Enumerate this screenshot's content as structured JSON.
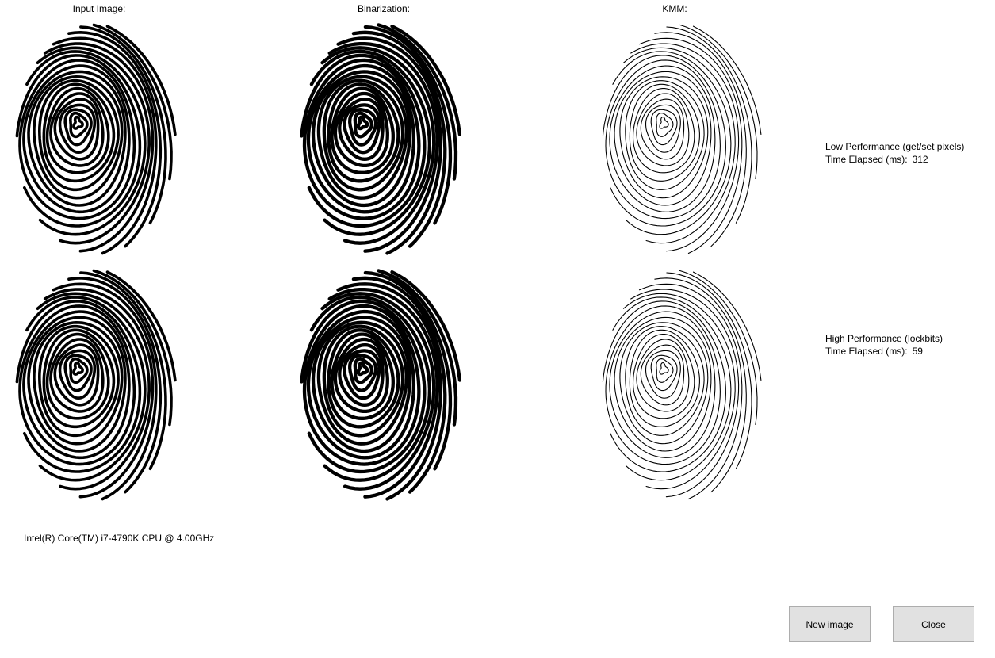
{
  "columns": {
    "input_title": "Input Image:",
    "binarization_title": "Binarization:",
    "kmm_title": "KMM:"
  },
  "low_performance": {
    "title": "Low Performance (get/set pixels)",
    "time_label": "Time Elapsed (ms):",
    "time_value": "312"
  },
  "high_performance": {
    "title": "High Performance (lockbits)",
    "time_label": "Time Elapsed (ms):",
    "time_value": "59"
  },
  "cpu": {
    "label": "Intel(R) Core(TM) i7-4790K CPU @ 4.00GHz"
  },
  "buttons": {
    "new_image": "New image",
    "close": "Close"
  },
  "colors": {
    "background": "#ffffff",
    "ink": "#000000",
    "button_bg": "#e1e1e1",
    "button_border": "#adadad"
  }
}
